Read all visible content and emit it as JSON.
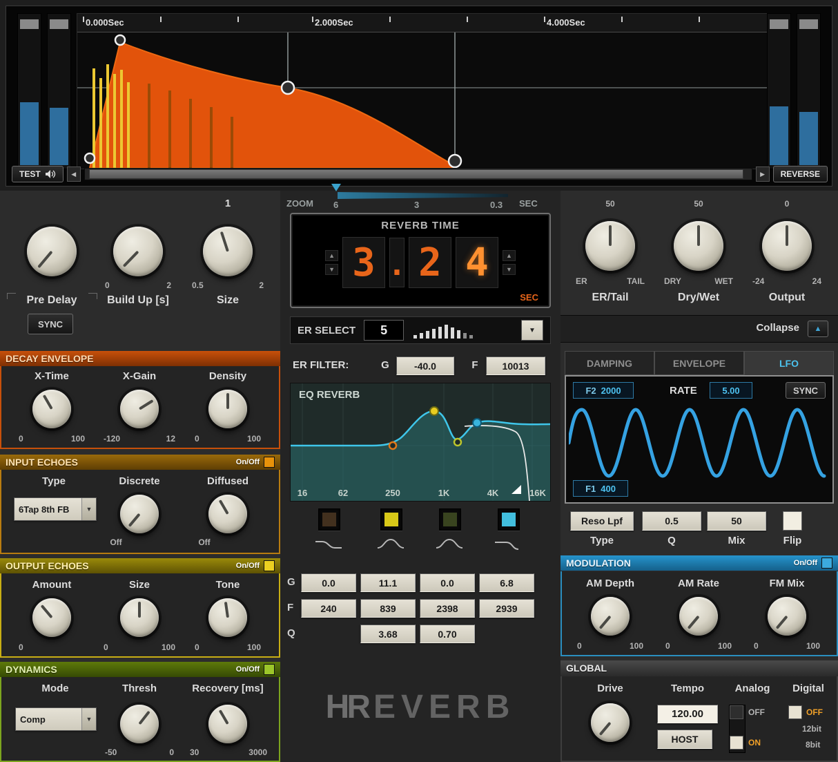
{
  "colors": {
    "accent_orange": "#e2530b",
    "accent_yellow": "#ecd020",
    "accent_green": "#9cc62a",
    "accent_blue": "#2f9fd0",
    "lfo_wave_blue": "#35a2e2",
    "eq_curve_cyan": "#3fc6ea",
    "digit_orange": "#e8651a"
  },
  "icons": {
    "dropdown_arrow": "▼",
    "spinner_up": "▲",
    "spinner_down": "▼",
    "scroll_left": "◀",
    "scroll_right": "▶",
    "collapse_up": "▲"
  },
  "top_display": {
    "time_labels": [
      "0.000Sec",
      "2.000Sec",
      "4.000Sec"
    ],
    "test_button": "TEST",
    "reverse_button": "REVERSE"
  },
  "zoom_bar": {
    "label": "ZOOM",
    "tick_left": "6",
    "tick_mid": "3",
    "tick_right": "0.3",
    "unit": "SEC"
  },
  "left_panel": {
    "main": {
      "pre_delay_label": "Pre Delay",
      "sync_button": "SYNC",
      "build_up_label": "Build Up [s]",
      "build_up_min": "0",
      "build_up_max": "2",
      "size_label": "Size",
      "size_value": "1",
      "size_min": "0.5",
      "size_max": "2"
    },
    "decay_envelope": {
      "title": "DECAY ENVELOPE",
      "knobs": [
        {
          "label": "X-Time",
          "min": "0",
          "max": "100"
        },
        {
          "label": "X-Gain",
          "min": "-120",
          "max": "12"
        },
        {
          "label": "Density",
          "min": "0",
          "max": "100"
        }
      ]
    },
    "input_echoes": {
      "title": "INPUT ECHOES",
      "onoff_label": "On/Off",
      "type_label": "Type",
      "type_value": "6Tap 8th FB",
      "discrete_label": "Discrete",
      "discrete_min": "Off",
      "diffused_label": "Diffused",
      "diffused_min": "Off"
    },
    "output_echoes": {
      "title": "OUTPUT ECHOES",
      "onoff_label": "On/Off",
      "knobs": [
        {
          "label": "Amount",
          "min": "0",
          "max": ""
        },
        {
          "label": "Size",
          "min": "0",
          "max": "100"
        },
        {
          "label": "Tone",
          "min": "0",
          "max": "100"
        }
      ]
    },
    "dynamics": {
      "title": "DYNAMICS",
      "onoff_label": "On/Off",
      "mode_label": "Mode",
      "mode_value": "Comp",
      "thresh_label": "Thresh",
      "thresh_min": "-50",
      "thresh_max": "0",
      "recovery_label": "Recovery [ms]",
      "recovery_min": "30",
      "recovery_max": "3000"
    }
  },
  "center_panel": {
    "reverb_time": {
      "title": "REVERB TIME",
      "digits": [
        "3",
        ".",
        "2",
        "4"
      ],
      "unit": "SEC"
    },
    "er_select": {
      "label": "ER SELECT",
      "value": "5"
    },
    "er_filter": {
      "label": "ER FILTER:",
      "g_label": "G",
      "g_value": "-40.0",
      "f_label": "F",
      "f_value": "10013"
    },
    "eq_display": {
      "title": "EQ REVERB",
      "freq_labels": [
        "16",
        "62",
        "250",
        "1K",
        "4K",
        "16K"
      ]
    },
    "band_table": {
      "g_label": "G",
      "f_label": "F",
      "q_label": "Q",
      "g_values": [
        "0.0",
        "11.1",
        "0.0",
        "6.8"
      ],
      "f_values": [
        "240",
        "839",
        "2398",
        "2939"
      ],
      "q_values": [
        "3.68",
        "0.70"
      ]
    },
    "logo": {
      "h": "H",
      "r": "R",
      "rest": "EVERB"
    }
  },
  "right_panel": {
    "er_tail": {
      "value": "50",
      "min": "ER",
      "max": "TAIL",
      "label": "ER/Tail"
    },
    "dry_wet": {
      "value": "50",
      "min": "DRY",
      "max": "WET",
      "label": "Dry/Wet"
    },
    "output": {
      "value": "0",
      "min": "-24",
      "max": "24",
      "label": "Output"
    },
    "collapse_label": "Collapse",
    "tabs": [
      "DAMPING",
      "ENVELOPE",
      "LFO"
    ],
    "lfo": {
      "f2_label": "F2",
      "f2_value": "2000",
      "rate_label": "RATE",
      "rate_value": "5.00",
      "sync_button": "SYNC",
      "f1_label": "F1",
      "f1_value": "400"
    },
    "filter_controls": {
      "type_value": "Reso Lpf",
      "q_value": "0.5",
      "mix_value": "50",
      "type_label": "Type",
      "q_label": "Q",
      "mix_label": "Mix",
      "flip_label": "Flip"
    },
    "modulation": {
      "title": "MODULATION",
      "onoff_label": "On/Off",
      "knobs": [
        {
          "label": "AM Depth",
          "min": "0",
          "max": "100"
        },
        {
          "label": "AM Rate",
          "min": "0",
          "max": "100"
        },
        {
          "label": "FM Mix",
          "min": "0",
          "max": "100"
        }
      ]
    },
    "global": {
      "title": "GLOBAL",
      "drive_label": "Drive",
      "tempo_label": "Tempo",
      "tempo_value": "120.00",
      "host_button": "HOST",
      "analog_label": "Analog",
      "analog_off": "OFF",
      "analog_on": "ON",
      "digital_label": "Digital",
      "digital_off": "OFF",
      "digital_12bit": "12bit",
      "digital_8bit": "8bit"
    }
  }
}
